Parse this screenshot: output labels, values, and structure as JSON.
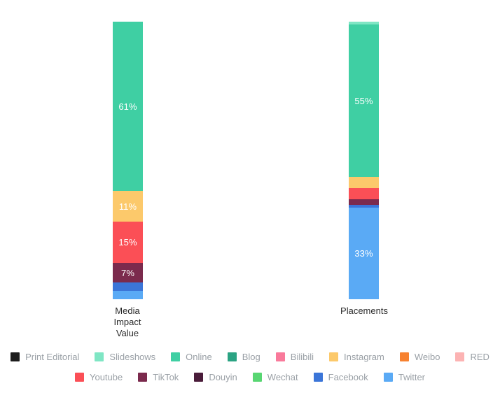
{
  "chart_data": {
    "type": "bar",
    "title": "",
    "subtitle": "",
    "xlabel": "",
    "ylabel": "",
    "stacked": true,
    "normalized": true,
    "ylim": [
      0,
      100
    ],
    "grid": false,
    "legend_position": "bottom",
    "categories": [
      "Media Impact Value",
      "Placements"
    ],
    "series": [
      {
        "name": "Print Editorial",
        "color": "#1c1c1c",
        "values": [
          0,
          0
        ]
      },
      {
        "name": "Slideshows",
        "color": "#7fe6c4",
        "values": [
          0,
          1
        ]
      },
      {
        "name": "Online",
        "color": "#3fcfa3",
        "values": [
          61,
          55
        ]
      },
      {
        "name": "Blog",
        "color": "#2ba383",
        "values": [
          0,
          0
        ]
      },
      {
        "name": "Bilibili",
        "color": "#f97a9b",
        "values": [
          0,
          0
        ]
      },
      {
        "name": "Instagram",
        "color": "#fcc96b",
        "values": [
          11,
          4
        ]
      },
      {
        "name": "Weibo",
        "color": "#f78230",
        "values": [
          0,
          0
        ]
      },
      {
        "name": "RED",
        "color": "#fcb3b3",
        "values": [
          0,
          0
        ]
      },
      {
        "name": "Youtube",
        "color": "#fb4f56",
        "values": [
          15,
          4
        ]
      },
      {
        "name": "TikTok",
        "color": "#7b2a4d",
        "values": [
          0,
          0
        ]
      },
      {
        "name": "Douyin",
        "color": "#4a1c3a",
        "values": [
          7,
          2
        ]
      },
      {
        "name": "Wechat",
        "color": "#58d672",
        "values": [
          0,
          0
        ]
      },
      {
        "name": "Facebook",
        "color": "#3b75d8",
        "values": [
          3,
          1
        ]
      },
      {
        "name": "Twitter",
        "color": "#5aaaf5",
        "values": [
          3,
          33
        ]
      }
    ],
    "bars": [
      {
        "category": "Media Impact Value",
        "category_lines": [
          "Media",
          "Impact",
          "Value"
        ],
        "segments": [
          {
            "name": "Online",
            "color": "#3fcfa3",
            "value": 61,
            "label": "61%",
            "show_label": true
          },
          {
            "name": "Instagram",
            "color": "#fcc96b",
            "value": 11,
            "label": "11%",
            "show_label": true
          },
          {
            "name": "Youtube",
            "color": "#fb4f56",
            "value": 15,
            "label": "15%",
            "show_label": true
          },
          {
            "name": "Douyin",
            "color": "#7b2a4d",
            "value": 7,
            "label": "7%",
            "show_label": true
          },
          {
            "name": "Facebook",
            "color": "#3b75d8",
            "value": 3,
            "label": "3%",
            "show_label": false
          },
          {
            "name": "Twitter",
            "color": "#5aaaf5",
            "value": 3,
            "label": "3%",
            "show_label": false
          }
        ]
      },
      {
        "category": "Placements",
        "category_lines": [
          "Placements"
        ],
        "segments": [
          {
            "name": "Slideshows",
            "color": "#7fe6c4",
            "value": 1,
            "label": "1%",
            "show_label": false
          },
          {
            "name": "Online",
            "color": "#3fcfa3",
            "value": 55,
            "label": "55%",
            "show_label": true
          },
          {
            "name": "Instagram",
            "color": "#fcc96b",
            "value": 4,
            "label": "4%",
            "show_label": false
          },
          {
            "name": "Youtube",
            "color": "#fb4f56",
            "value": 4,
            "label": "4%",
            "show_label": false
          },
          {
            "name": "Douyin",
            "color": "#7b2a4d",
            "value": 2,
            "label": "2%",
            "show_label": false
          },
          {
            "name": "Facebook",
            "color": "#3b75d8",
            "value": 1,
            "label": "1%",
            "show_label": false
          },
          {
            "name": "Twitter",
            "color": "#5aaaf5",
            "value": 33,
            "label": "33%",
            "show_label": true
          }
        ]
      }
    ]
  },
  "legend": {
    "rows": [
      [
        {
          "label": "Print Editorial",
          "color": "#1c1c1c"
        },
        {
          "label": "Slideshows",
          "color": "#7fe6c4"
        },
        {
          "label": "Online",
          "color": "#3fcfa3"
        },
        {
          "label": "Blog",
          "color": "#2ba383"
        },
        {
          "label": "Bilibili",
          "color": "#f97a9b"
        },
        {
          "label": "Instagram",
          "color": "#fcc96b"
        },
        {
          "label": "Weibo",
          "color": "#f78230"
        },
        {
          "label": "RED",
          "color": "#fcb3b3"
        }
      ],
      [
        {
          "label": "Youtube",
          "color": "#fb4f56"
        },
        {
          "label": "TikTok",
          "color": "#7b2a4d"
        },
        {
          "label": "Douyin",
          "color": "#4a1c3a"
        },
        {
          "label": "Wechat",
          "color": "#58d672"
        },
        {
          "label": "Facebook",
          "color": "#3b75d8"
        },
        {
          "label": "Twitter",
          "color": "#5aaaf5"
        }
      ]
    ]
  },
  "style": {
    "background": "#ffffff",
    "label_color": "#ffffff",
    "legend_text_color": "#9aa0a6",
    "category_text_color": "#2b2b2b"
  }
}
